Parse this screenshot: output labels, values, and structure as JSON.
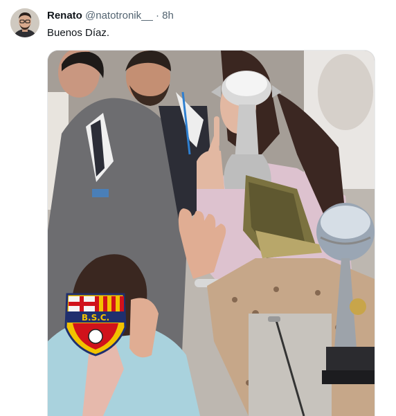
{
  "tweet": {
    "author_name": "Renato",
    "author_handle": "@natotronik__",
    "separator": "·",
    "time": "8h",
    "text": "Buenos Díaz."
  },
  "media": {
    "badge_text": "B.S.C.",
    "badge_colors": {
      "yellow": "#f2c200",
      "red": "#d0121b",
      "navy": "#1f2f6e"
    }
  }
}
